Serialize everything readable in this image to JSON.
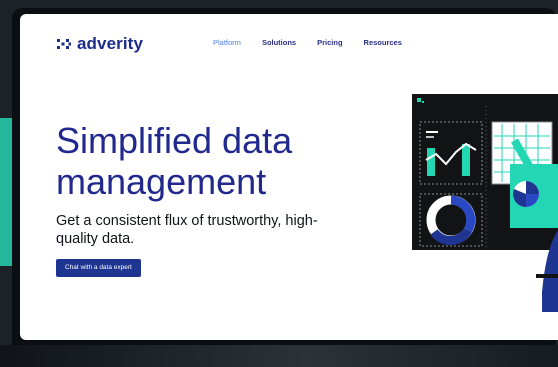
{
  "logo": {
    "text": "adverity"
  },
  "nav": {
    "items": [
      {
        "label": "Platform",
        "active": true
      },
      {
        "label": "Solutions",
        "active": false
      },
      {
        "label": "Pricing",
        "active": false
      },
      {
        "label": "Resources",
        "active": false
      }
    ]
  },
  "hero": {
    "title_line1": "Simplified data",
    "title_line2": "management",
    "subtitle": "Get a consistent flux of trustworthy, high-quality data.",
    "cta_label": "Chat with a data expert"
  },
  "colors": {
    "brand_navy": "#21298e",
    "accent_teal": "#23b89c",
    "nav_active": "#4d7ee6",
    "cta_bg": "#1e3592"
  },
  "icons": [
    "adverity-logo-icon",
    "dashboard-illustration",
    "laptop-icon"
  ]
}
